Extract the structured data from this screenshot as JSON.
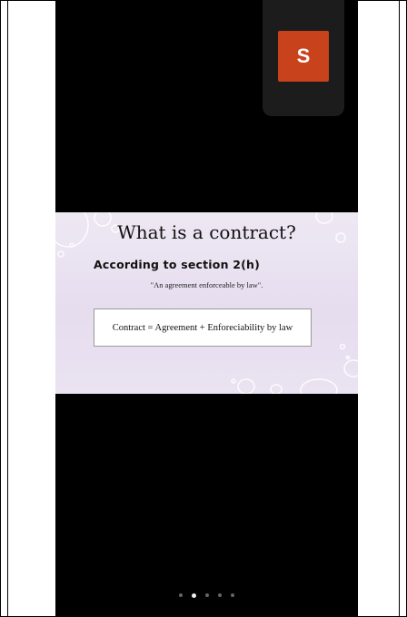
{
  "participant": {
    "initial": "S"
  },
  "slide": {
    "title": "What is a contract?",
    "subtitle": "According to section 2(h)",
    "quote": "\"An agreement enforceable by law\".",
    "equation": "Contract = Agreement + Enforeciability by law"
  },
  "pager": {
    "count": 5,
    "active_index": 1
  },
  "colors": {
    "avatar_bg": "#c8421c",
    "phone_bg": "#000000",
    "slide_bg": "#e9e1f1"
  }
}
